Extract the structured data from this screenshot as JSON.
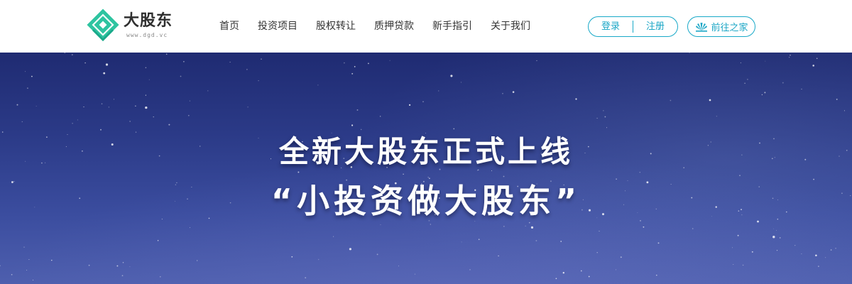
{
  "brand": {
    "name": "大股东",
    "url": "www.dgd.vc",
    "accent_color": "#1aa6c6",
    "logo_color": "#2ec4a0"
  },
  "nav": {
    "items": [
      {
        "label": "首页"
      },
      {
        "label": "投资项目"
      },
      {
        "label": "股权转让"
      },
      {
        "label": "质押贷款"
      },
      {
        "label": "新手指引"
      },
      {
        "label": "关于我们"
      }
    ]
  },
  "auth": {
    "login_label": "登录",
    "register_label": "注册"
  },
  "home_link": {
    "label": "前往之家",
    "icon": "fan-icon"
  },
  "hero": {
    "title": "全新大股东正式上线",
    "slogan": "“小投资做大股东”",
    "background": "starry-night-sky"
  }
}
